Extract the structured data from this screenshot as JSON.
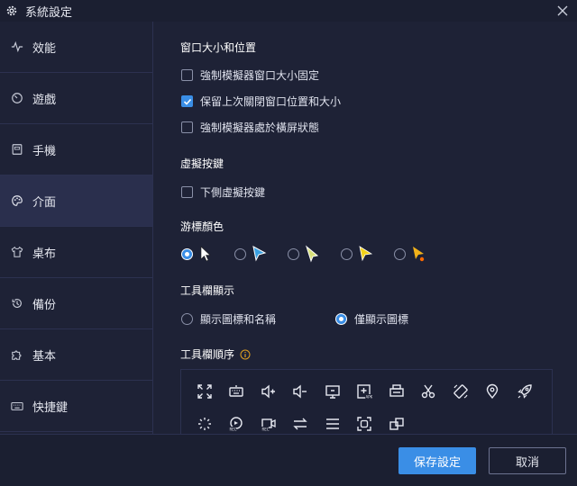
{
  "window": {
    "title": "系統設定"
  },
  "sidebar": {
    "items": [
      {
        "label": "效能",
        "icon": "performance-icon",
        "active": false
      },
      {
        "label": "遊戲",
        "icon": "game-icon",
        "active": false
      },
      {
        "label": "手機",
        "icon": "phone-icon",
        "active": false
      },
      {
        "label": "介面",
        "icon": "palette-icon",
        "active": true
      },
      {
        "label": "桌布",
        "icon": "shirt-icon",
        "active": false
      },
      {
        "label": "備份",
        "icon": "history-icon",
        "active": false
      },
      {
        "label": "基本",
        "icon": "puzzle-icon",
        "active": false
      },
      {
        "label": "快捷鍵",
        "icon": "keyboard-icon",
        "active": false
      }
    ]
  },
  "window_section": {
    "title": "窗口大小和位置",
    "options": [
      {
        "label": "強制模擬器窗口大小固定",
        "checked": false
      },
      {
        "label": "保留上次關閉窗口位置和大小",
        "checked": true
      },
      {
        "label": "強制模擬器處於橫屏狀態",
        "checked": false
      }
    ]
  },
  "virtual_keys": {
    "title": "虛擬按鍵",
    "options": [
      {
        "label": "下側虛擬按鍵",
        "checked": false
      }
    ]
  },
  "cursor_color": {
    "title": "游標顏色",
    "selected_index": 0,
    "options": [
      "white-cursor-icon",
      "blue-cursor-icon",
      "yellow-green-cursor-icon",
      "yellow-cursor-icon",
      "orange-dot-cursor-icon"
    ]
  },
  "toolbar_display": {
    "title": "工具欄顯示",
    "options": [
      {
        "label": "顯示圖標和名稱",
        "selected": false
      },
      {
        "label": "僅顯示圖標",
        "selected": true
      }
    ]
  },
  "toolbar_order": {
    "title": "工具欄順序",
    "icons": [
      "fullscreen-icon",
      "keyboard-icon",
      "volume-up-icon",
      "volume-down-icon",
      "screenshot-icon",
      "add-apk-icon",
      "printer-icon",
      "cut-icon",
      "rotate-icon",
      "location-icon",
      "rocket-icon",
      "loading-icon",
      "record-icon",
      "video-record-icon",
      "sync-icon",
      "menu-icon",
      "capture-icon",
      "multi-window-icon"
    ]
  },
  "footer": {
    "save_label": "保存設定",
    "cancel_label": "取消"
  },
  "colors": {
    "accent": "#3a8ee6",
    "background": "#1e2236",
    "active": "#2a2f4d"
  }
}
